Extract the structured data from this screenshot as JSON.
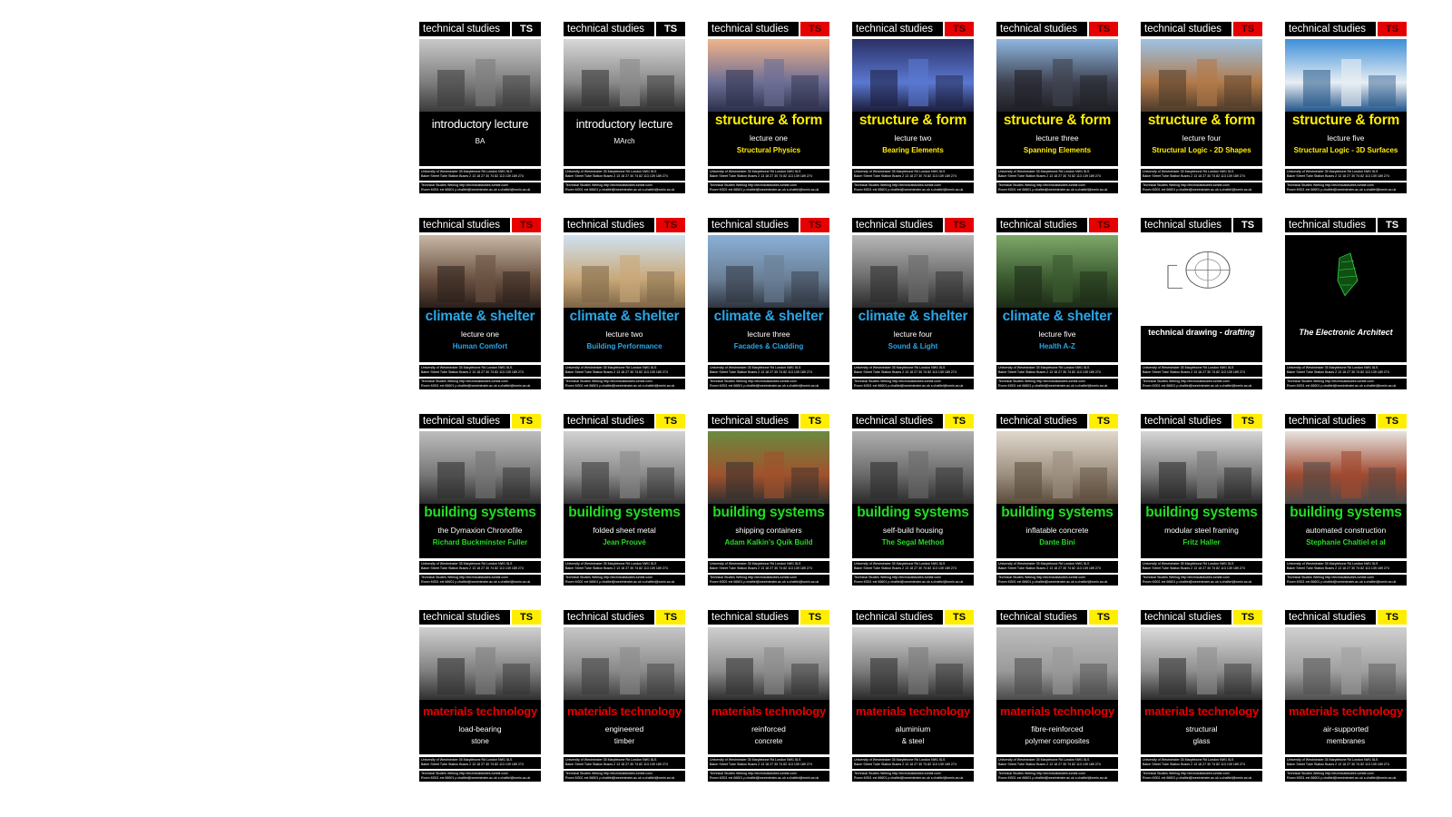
{
  "footer": {
    "univ_line1": "University of Westminster          35 Marylebone Rd London NW1 5LS",
    "univ_line2": "Baker Street Tube Station    Buses 2 13 18 27 30 74 82 113 139 189 274",
    "web_line1": "Technical Studies Weblog          http://technicalstudies.tumblr.com/",
    "web_line2": "Room M301  ext 66601  p.chaltiel@westminster.ac.uk  s.chaltiel@wmin.ac.uk"
  },
  "colors": {
    "black": "#000000",
    "red": "#e60000",
    "yellow": "#ffee00",
    "blue": "#2aa6e8",
    "green": "#22dd22"
  },
  "posters": [
    {
      "series": "technical studies",
      "badge": "TS",
      "badge_color": "black",
      "title": "introductory lecture",
      "title_color": "white",
      "line1": "",
      "line2": "BA",
      "line2_color": "white",
      "image": "planetarium-dome"
    },
    {
      "series": "technical studies",
      "badge": "TS",
      "badge_color": "black",
      "title": "introductory lecture",
      "title_color": "white",
      "line1": "",
      "line2": "MArch",
      "line2_color": "white",
      "image": "cable-net-roof"
    },
    {
      "series": "technical studies",
      "badge": "TS",
      "badge_color": "red",
      "title": "structure & form",
      "title_color": "yellow",
      "line1": "lecture one",
      "line2": "Structural Physics",
      "line2_color": "yellow",
      "image": "skyscraper-skyline"
    },
    {
      "series": "technical studies",
      "badge": "TS",
      "badge_color": "red",
      "title": "structure & form",
      "title_color": "yellow",
      "line1": "lecture two",
      "line2": "Bearing Elements",
      "line2_color": "yellow",
      "image": "illuminated-pavilion"
    },
    {
      "series": "technical studies",
      "badge": "TS",
      "badge_color": "red",
      "title": "structure & form",
      "title_color": "yellow",
      "line1": "lecture three",
      "line2": "Spanning Elements",
      "line2_color": "yellow",
      "image": "steel-roof-hall"
    },
    {
      "series": "technical studies",
      "badge": "TS",
      "badge_color": "red",
      "title": "structure & form",
      "title_color": "yellow",
      "line1": "lecture four",
      "line2": "Structural Logic - 2D Shapes",
      "line2_color": "yellow",
      "image": "timber-pavilion"
    },
    {
      "series": "technical studies",
      "badge": "TS",
      "badge_color": "red",
      "title": "structure & form",
      "title_color": "yellow",
      "line1": "lecture five",
      "line2": "Structural Logic - 3D Surfaces",
      "line2_color": "yellow",
      "image": "shell-roof-water"
    },
    {
      "series": "technical studies",
      "badge": "TS",
      "badge_color": "red",
      "title": "climate & shelter",
      "title_color": "blue",
      "line1": "lecture one",
      "line2": "Human Comfort",
      "line2_color": "blue",
      "image": "people-in-parkas"
    },
    {
      "series": "technical studies",
      "badge": "TS",
      "badge_color": "red",
      "title": "climate & shelter",
      "title_color": "blue",
      "line1": "lecture two",
      "line2": "Building Performance",
      "line2_color": "blue",
      "image": "wind-towers"
    },
    {
      "series": "technical studies",
      "badge": "TS",
      "badge_color": "red",
      "title": "climate & shelter",
      "title_color": "blue",
      "line1": "lecture three",
      "line2": "Facades & Cladding",
      "line2_color": "blue",
      "image": "glass-office-block"
    },
    {
      "series": "technical studies",
      "badge": "TS",
      "badge_color": "red",
      "title": "climate & shelter",
      "title_color": "blue",
      "line1": "lecture four",
      "line2": "Sound & Light",
      "line2_color": "blue",
      "image": "concert-hall-interior"
    },
    {
      "series": "technical studies",
      "badge": "TS",
      "badge_color": "red",
      "title": "climate & shelter",
      "title_color": "blue",
      "line1": "lecture five",
      "line2": "Health A-Z",
      "line2_color": "blue",
      "image": "garden-pavilion"
    },
    {
      "series": "technical studies",
      "badge": "TS",
      "badge_color": "black",
      "kind": "full",
      "caption": "technical drawing - ",
      "caption_italic": "drafting",
      "image": "vitruvian-drawing"
    },
    {
      "series": "technical studies",
      "badge": "TS",
      "badge_color": "black",
      "kind": "full",
      "caption": "",
      "caption_italic": "The Electronic Architect",
      "image": "green-wireframe"
    },
    {
      "series": "technical studies",
      "badge": "TS",
      "badge_color": "yellow",
      "title": "building systems",
      "title_color": "green",
      "line1": "the Dymaxion Chronofile",
      "line2": "Richard Buckminster Fuller",
      "line2_color": "green",
      "image": "fuller-portrait"
    },
    {
      "series": "technical studies",
      "badge": "TS",
      "badge_color": "yellow",
      "title": "building systems",
      "title_color": "green",
      "line1": "folded sheet metal",
      "line2": "Jean Prouvé",
      "line2_color": "green",
      "image": "prouve-portrait"
    },
    {
      "series": "technical studies",
      "badge": "TS",
      "badge_color": "yellow",
      "title": "building systems",
      "title_color": "green",
      "line1": "shipping containers",
      "line2": "Adam Kalkin's Quik Build",
      "line2_color": "green",
      "image": "container-house"
    },
    {
      "series": "technical studies",
      "badge": "TS",
      "badge_color": "yellow",
      "title": "building systems",
      "title_color": "green",
      "line1": "self-build housing",
      "line2": "The Segal Method",
      "line2_color": "green",
      "image": "segal-portrait"
    },
    {
      "series": "technical studies",
      "badge": "TS",
      "badge_color": "yellow",
      "title": "building systems",
      "title_color": "green",
      "line1": "inflatable concrete",
      "line2": "Dante Bini",
      "line2_color": "green",
      "image": "bini-portrait"
    },
    {
      "series": "technical studies",
      "badge": "TS",
      "badge_color": "yellow",
      "title": "building systems",
      "title_color": "green",
      "line1": "modular steel framing",
      "line2": "Fritz Haller",
      "line2_color": "green",
      "image": "haller-portrait"
    },
    {
      "series": "technical studies",
      "badge": "TS",
      "badge_color": "yellow",
      "title": "building systems",
      "title_color": "green",
      "line1": "automated construction",
      "line2": "Stephanie Chaltiel et al",
      "line2_color": "green",
      "image": "drone-portrait"
    },
    {
      "series": "technical studies",
      "badge": "TS",
      "badge_color": "yellow",
      "title": "materials technology",
      "title_color": "red",
      "line1": "load-bearing",
      "line2": "stone",
      "line2_color": "white",
      "image": "stone-loader"
    },
    {
      "series": "technical studies",
      "badge": "TS",
      "badge_color": "yellow",
      "title": "materials technology",
      "title_color": "red",
      "line1": "engineered",
      "line2": "timber",
      "line2_color": "white",
      "image": "timber-log"
    },
    {
      "series": "technical studies",
      "badge": "TS",
      "badge_color": "yellow",
      "title": "materials technology",
      "title_color": "red",
      "line1": "reinforced",
      "line2": "concrete",
      "line2_color": "white",
      "image": "rebar-cage"
    },
    {
      "series": "technical studies",
      "badge": "TS",
      "badge_color": "yellow",
      "title": "materials technology",
      "title_color": "red",
      "line1": "aluminium",
      "line2": "& steel",
      "line2_color": "white",
      "image": "metal-workers"
    },
    {
      "series": "technical studies",
      "badge": "TS",
      "badge_color": "yellow",
      "title": "materials technology",
      "title_color": "red",
      "line1": "fibre-reinforced",
      "line2": "polymer composites",
      "line2_color": "white",
      "image": "composite-block"
    },
    {
      "series": "technical studies",
      "badge": "TS",
      "badge_color": "yellow",
      "title": "materials technology",
      "title_color": "red",
      "line1": "structural",
      "line2": "glass",
      "line2_color": "white",
      "image": "glass-panel"
    },
    {
      "series": "technical studies",
      "badge": "TS",
      "badge_color": "yellow",
      "title": "materials technology",
      "title_color": "red",
      "line1": "air-supported",
      "line2": "membranes",
      "line2_color": "white",
      "image": "airship-hangar"
    }
  ]
}
